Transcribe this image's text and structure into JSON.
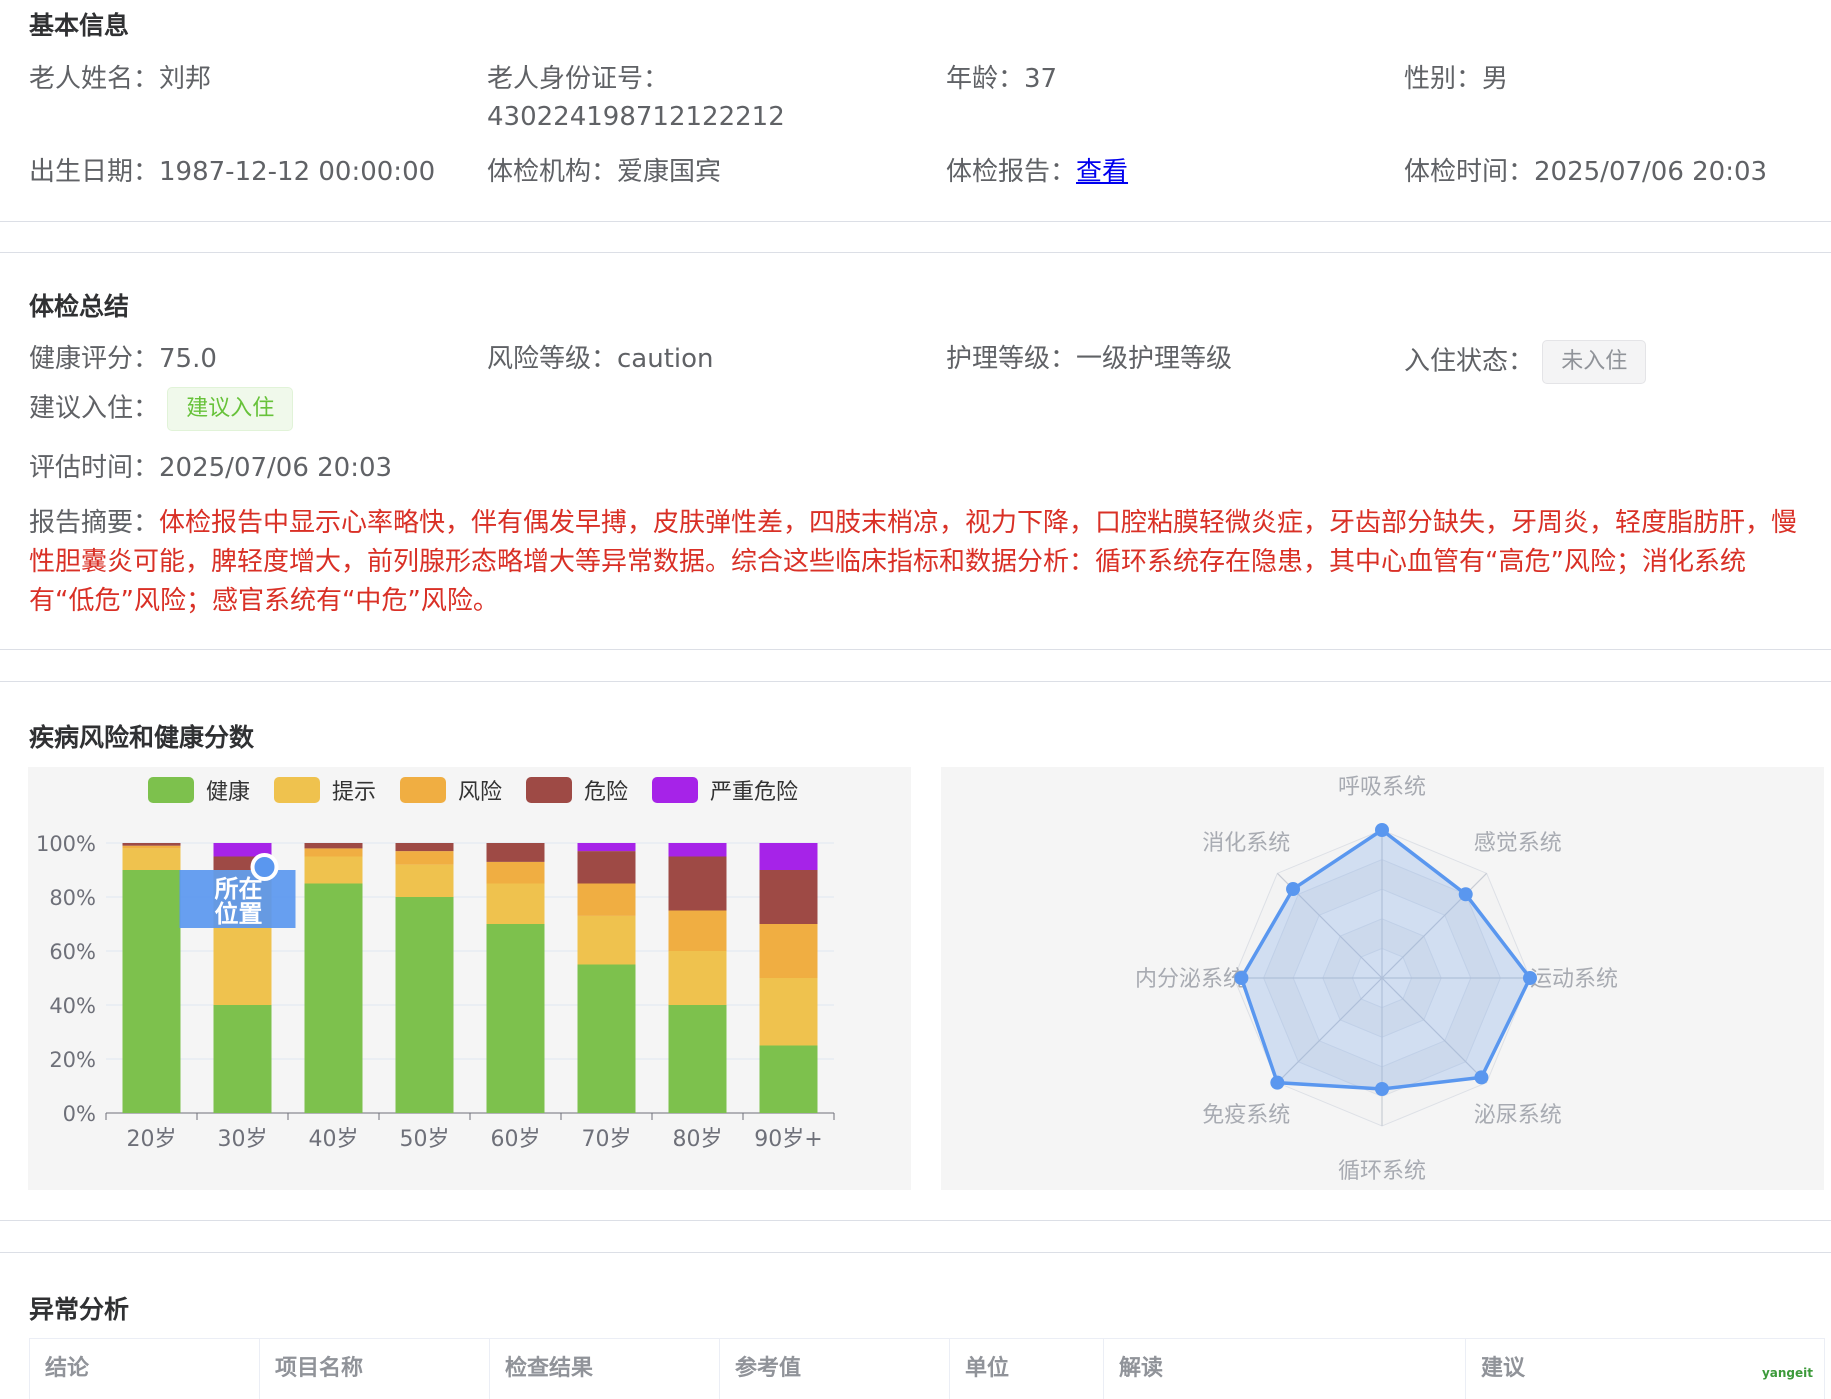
{
  "basic": {
    "title": "基本信息",
    "name_label": "老人姓名：",
    "name": "刘邦",
    "id_label": "老人身份证号：",
    "id": "430224198712122212",
    "age_label": "年龄：",
    "age": "37",
    "gender_label": "性别：",
    "gender": "男",
    "birth_label": "出生日期：",
    "birth": "1987-12-12 00:00:00",
    "org_label": "体检机构：",
    "org": "爱康国宾",
    "report_label": "体检报告：",
    "report_link": "查看",
    "time_label": "体检时间：",
    "time": "2025/07/06 20:03"
  },
  "summary": {
    "title": "体检总结",
    "score_label": "健康评分：",
    "score": "75.0",
    "risk_label": "风险等级：",
    "risk": "caution",
    "care_label": "护理等级：",
    "care": "一级护理等级",
    "status_label": "入住状态：",
    "status_tag": "未入住",
    "suggest_label": "建议入住：",
    "suggest_tag": "建议入住",
    "eval_label": "评估时间：",
    "eval_time": "2025/07/06 20:03",
    "abstract_label": "报告摘要：",
    "abstract_text": "体检报告中显示心率略快，伴有偶发早搏，皮肤弹性差，四肢末梢凉，视力下降，口腔粘膜轻微炎症，牙齿部分缺失，牙周炎，轻度脂肪肝，慢性胆囊炎可能，脾轻度增大，前列腺形态略增大等异常数据。综合这些临床指标和数据分析：循环系统存在隐患，其中心血管有“高危”风险；消化系统有“低危”风险；感官系统有“中危”风险。"
  },
  "charts": {
    "title": "疾病风险和健康分数",
    "marker_text_1": "所在",
    "marker_text_2": "位置"
  },
  "chart_data": [
    {
      "type": "bar",
      "stacked": true,
      "categories": [
        "20岁",
        "30岁",
        "40岁",
        "50岁",
        "60岁",
        "70岁",
        "80岁",
        "90岁+"
      ],
      "y_ticks": [
        "0%",
        "20%",
        "40%",
        "60%",
        "80%",
        "100%"
      ],
      "ylim": [
        0,
        100
      ],
      "legend_position": "top",
      "highlighted_category": "30岁",
      "series": [
        {
          "name": "健康",
          "color": "#7dc14d",
          "values": [
            90,
            40,
            85,
            80,
            70,
            55,
            40,
            25
          ]
        },
        {
          "name": "提示",
          "color": "#efc24e",
          "values": [
            8,
            45,
            10,
            12,
            15,
            18,
            20,
            25
          ]
        },
        {
          "name": "风险",
          "color": "#f0ae42",
          "values": [
            1,
            5,
            3,
            5,
            8,
            12,
            15,
            20
          ]
        },
        {
          "name": "危险",
          "color": "#9e4a45",
          "values": [
            1,
            5,
            2,
            3,
            7,
            12,
            20,
            20
          ]
        },
        {
          "name": "严重危险",
          "color": "#a623e8",
          "values": [
            0,
            5,
            0,
            0,
            0,
            3,
            5,
            10
          ]
        }
      ]
    },
    {
      "type": "radar",
      "axes": [
        "呼吸系统",
        "感觉系统",
        "运动系统",
        "泌尿系统",
        "循环系统",
        "免疫系统",
        "内分泌系统",
        "消化系统"
      ],
      "max": 100,
      "line_color": "#5a97ef",
      "values": [
        100,
        80,
        100,
        95,
        75,
        100,
        95,
        85
      ]
    }
  ],
  "abnormal": {
    "title": "异常分析",
    "columns": [
      "结论",
      "项目名称",
      "检查结果",
      "参考值",
      "单位",
      "解读",
      "建议"
    ]
  },
  "watermark": "yangeit"
}
